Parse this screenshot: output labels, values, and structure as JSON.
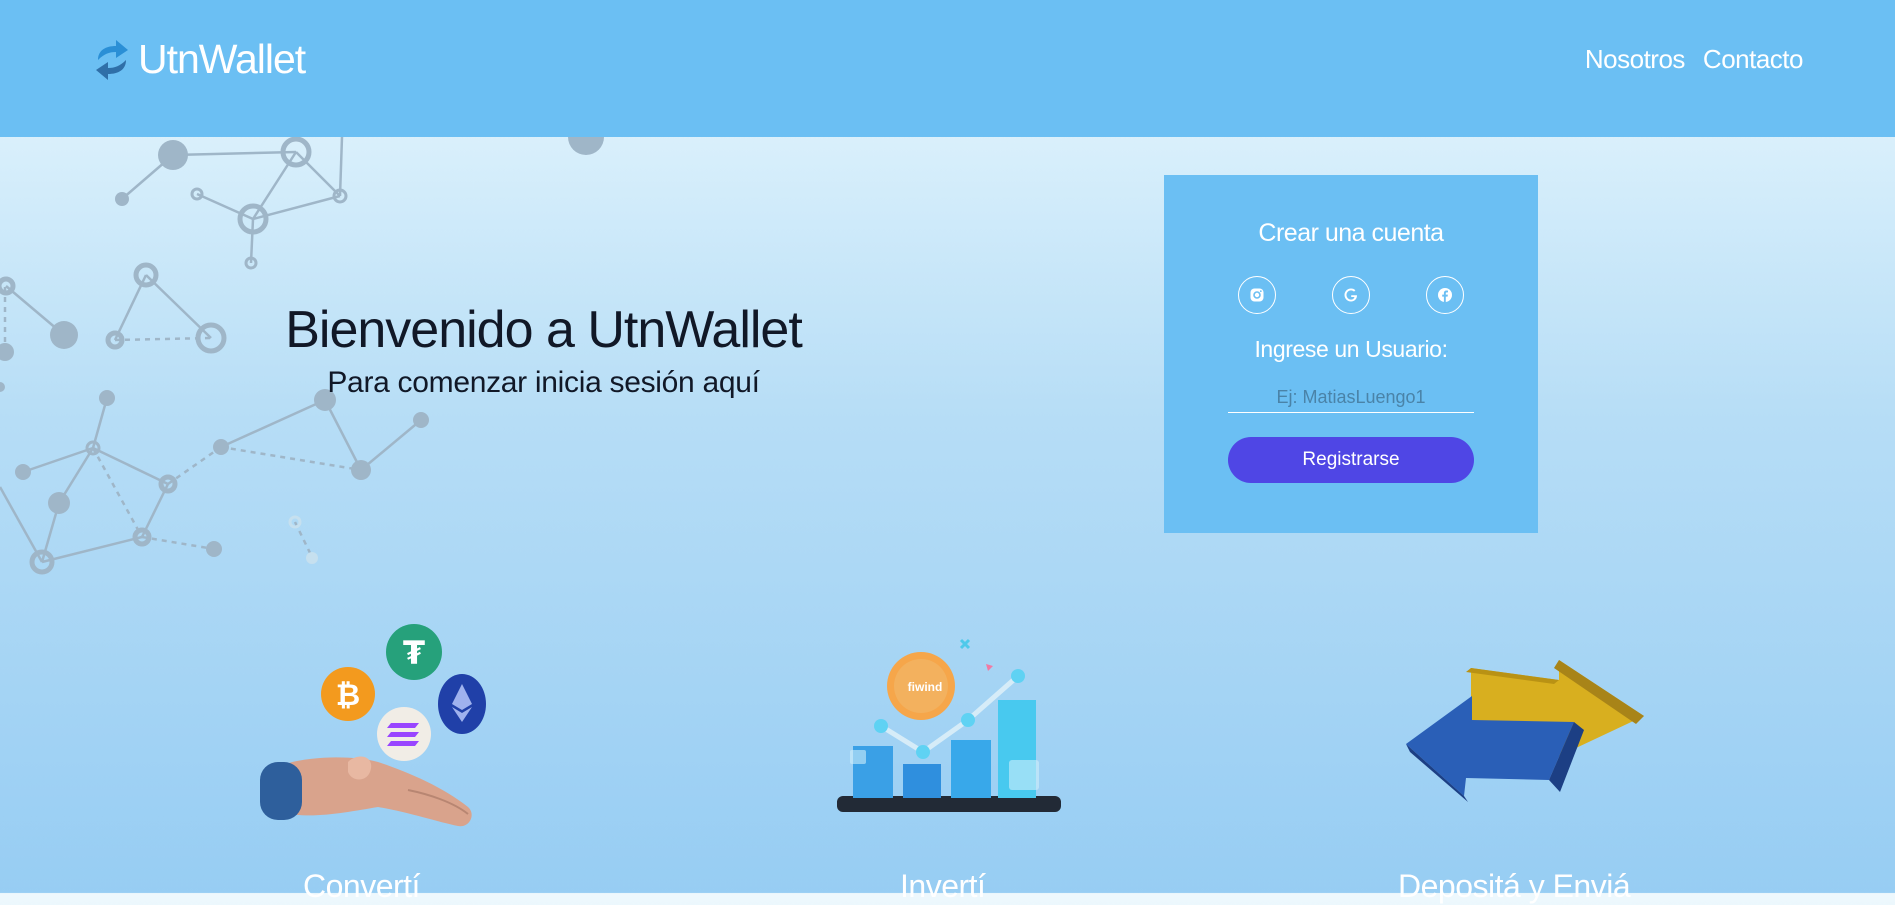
{
  "header": {
    "brand": "UtnWallet",
    "nav": [
      {
        "label": "Nosotros"
      },
      {
        "label": "Contacto"
      }
    ]
  },
  "hero": {
    "title": "Bienvenido a UtnWallet",
    "subtitle": "Para comenzar inicia sesión aquí"
  },
  "signup": {
    "title": "Crear una cuenta",
    "socials": [
      "instagram-icon",
      "google-icon",
      "facebook-icon"
    ],
    "user_label": "Ingrese un Usuario:",
    "user_placeholder": "Ej: MatiasLuengo1",
    "user_value": "",
    "register_label": "Registrarse"
  },
  "features": [
    {
      "title": "Convertí",
      "icon": "crypto-coins-hand"
    },
    {
      "title": "Invertí",
      "icon": "growth-chart-coin",
      "coin_text": "fiwind"
    },
    {
      "title": "Depositá y Enviá",
      "icon": "transfer-arrows"
    }
  ],
  "colors": {
    "header_bg": "#6bbff3",
    "card_bg": "#6bbff3",
    "button_bg": "#4f46e5",
    "text_dark": "#111827"
  }
}
